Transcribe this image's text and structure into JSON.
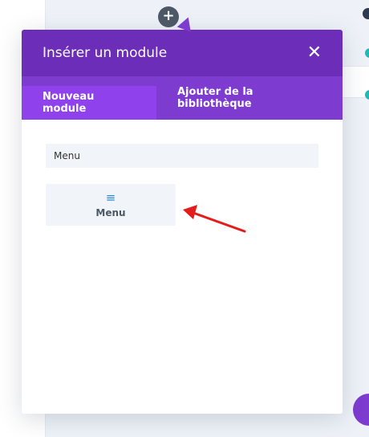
{
  "modal": {
    "title": "Insérer un module",
    "tabs": [
      {
        "label": "Nouveau module"
      },
      {
        "label": "Ajouter de la bibliothèque"
      }
    ],
    "search": {
      "value": "Menu"
    },
    "modules": [
      {
        "label": "Menu",
        "icon": "hamburger-menu-icon"
      }
    ]
  },
  "colors": {
    "header": "#6c2eb9",
    "tabs_bar": "#7d3bcf",
    "active_tab": "#8f42ec",
    "annotation_arrow": "#e41c1c"
  }
}
